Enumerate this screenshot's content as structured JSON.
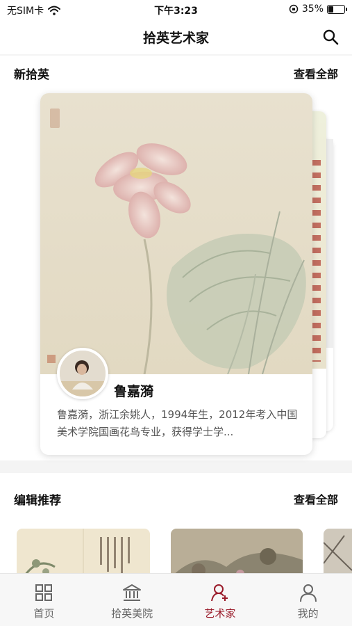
{
  "status_bar": {
    "carrier": "无SIM卡",
    "time": "下午3:23",
    "battery_percent": "35%",
    "battery_level": 0.35
  },
  "navbar": {
    "title": "拾英艺术家"
  },
  "new_section": {
    "title": "新拾英",
    "more": "查看全部",
    "card": {
      "artist_name": "鲁嘉漪",
      "bio": "鲁嘉漪，浙江余姚人，1994年生，2012年考入中国美术学院国画花鸟专业，获得学士学..."
    }
  },
  "editor_section": {
    "title": "编辑推荐",
    "more": "查看全部"
  },
  "tabbar": {
    "active": "tab-artists",
    "items": [
      {
        "label": "首页",
        "icon": "grid-icon"
      },
      {
        "label": "拾英美院",
        "icon": "museum-icon"
      },
      {
        "label": "艺术家",
        "icon": "artist-add-icon"
      },
      {
        "label": "我的",
        "icon": "person-icon"
      }
    ]
  },
  "colors": {
    "accent": "#9a1b2a",
    "tab_inactive": "#666666"
  }
}
